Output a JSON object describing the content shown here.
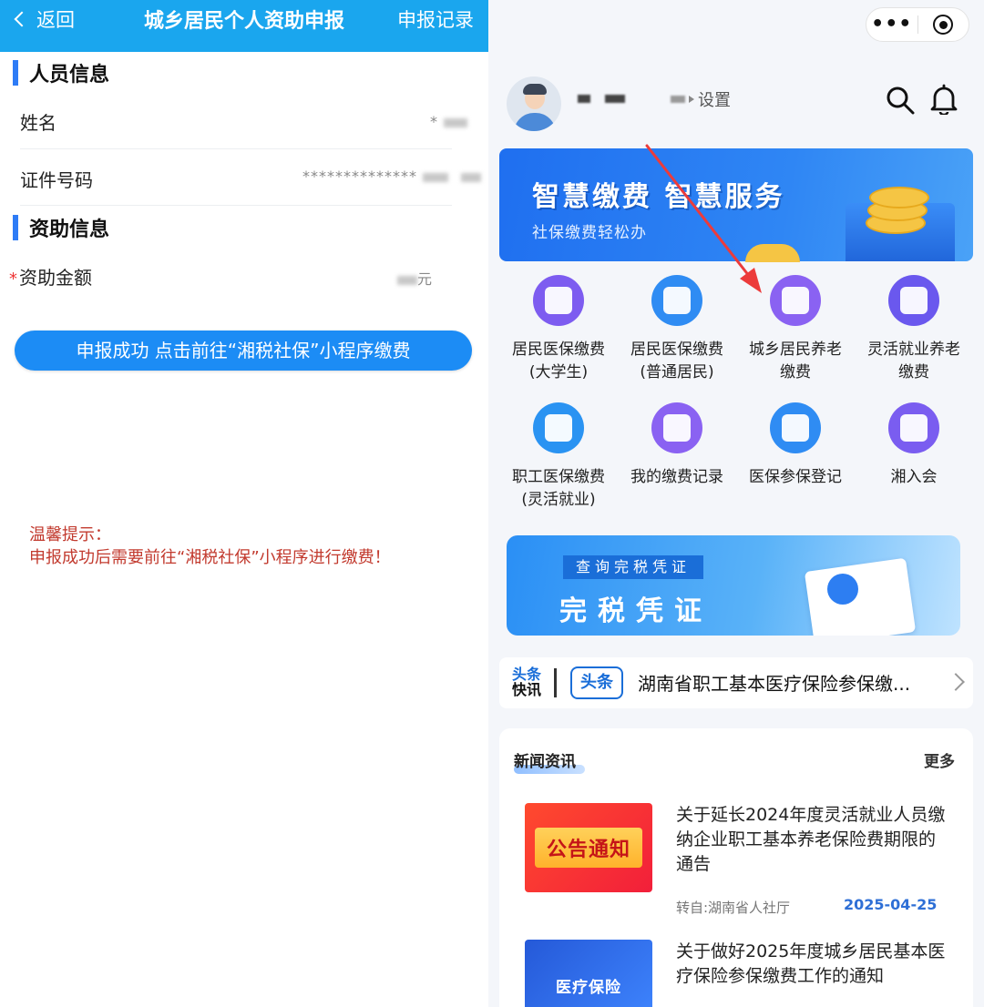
{
  "left": {
    "topbar": {
      "back_label": "返回",
      "title": "城乡居民个人资助申报",
      "record_label": "申报记录"
    },
    "person_section": {
      "title": "人员信息"
    },
    "name_field": {
      "label": "姓名",
      "value": "*"
    },
    "id_field": {
      "label": "证件号码",
      "value": "**************"
    },
    "subsidy_section": {
      "title": "资助信息"
    },
    "amount_field": {
      "required_mark": "*",
      "label": "资助金额",
      "unit": "元"
    },
    "success_button": "申报成功  点击前往“湘税社保”小程序缴费",
    "tip": {
      "title": "温馨提示：",
      "body": "申报成功后需要前往“湘税社保”小程序进行缴费！"
    }
  },
  "right": {
    "capsule": {
      "more": "•••"
    },
    "user": {
      "settings_label": "设置"
    },
    "banner1": {
      "headline": "智慧缴费  智慧服务",
      "subtitle": "社保缴费轻松办"
    },
    "services": [
      {
        "line1": "居民医保缴费",
        "line2": "(大学生)",
        "color": "#7d5cf0",
        "icon": "graduation-cap-icon"
      },
      {
        "line1": "居民医保缴费",
        "line2": "(普通居民)",
        "color": "#2f8cf3",
        "icon": "buildings-icon"
      },
      {
        "line1": "城乡居民养老",
        "line2": "缴费",
        "color": "#8a62f2",
        "icon": "payment-terminal-icon"
      },
      {
        "line1": "灵活就业养老",
        "line2": "缴费",
        "color": "#6a58ee",
        "icon": "briefcase-icon"
      },
      {
        "line1": "职工医保缴费",
        "line2": "(灵活就业)",
        "color": "#2a93f2",
        "icon": "id-card-icon"
      },
      {
        "line1": "我的缴费记录",
        "line2": "",
        "color": "#8a62f2",
        "icon": "records-icon"
      },
      {
        "line1": "医保参保登记",
        "line2": "",
        "color": "#2f8cf3",
        "icon": "medical-cross-icon"
      },
      {
        "line1": "湘入会",
        "line2": "",
        "color": "#7a5df0",
        "icon": "house-icon"
      }
    ],
    "banner2": {
      "tag": "查询完税凭证",
      "headline": "完税凭证"
    },
    "headline_bar": {
      "brand_top": "头条",
      "brand_bottom": "快讯",
      "pill": "头条",
      "text": "湖南省职工基本医疗保险参保缴..."
    },
    "news": {
      "title": "新闻资讯",
      "more": "更多",
      "items": [
        {
          "title": "关于延长2024年度灵活就业人员缴纳企业职工基本养老保险费期限的通告",
          "thumb_text": "公告通知",
          "source": "转自:湖南省人社厅",
          "date": "2025-04-25"
        },
        {
          "title": "关于做好2025年度城乡居民基本医疗保险参保缴费工作的通知",
          "thumb_text": "医疗保险"
        }
      ]
    },
    "colors": {
      "accent": "#1aa6ee",
      "button": "#1c8cf5",
      "tip": "#c23a2e",
      "arrow": "#ec3b3b"
    }
  }
}
